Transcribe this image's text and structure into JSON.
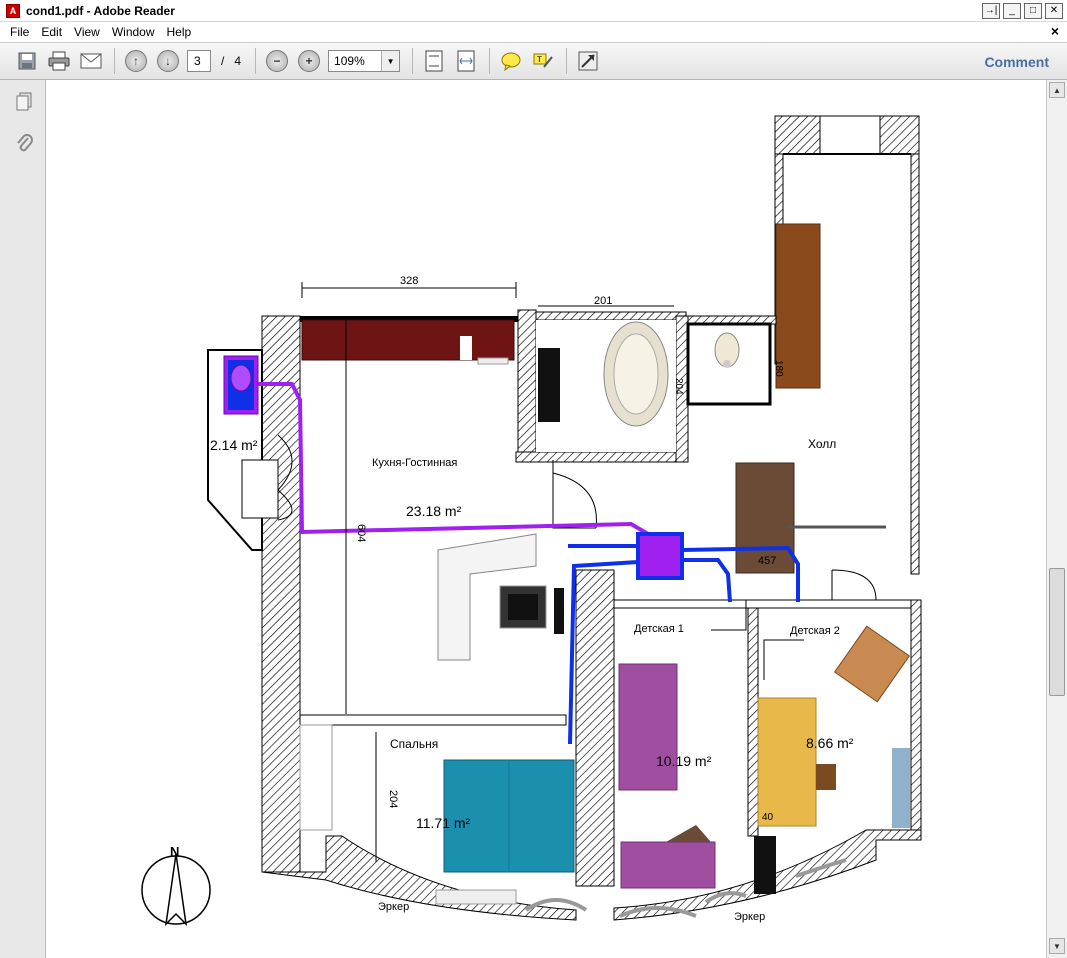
{
  "window": {
    "title": "cond1.pdf - Adobe Reader",
    "pdf_badge": "A"
  },
  "window_controls": {
    "restore": "→|",
    "minimize": "_",
    "maximize": "□",
    "close": "✕"
  },
  "menu": {
    "items": [
      "File",
      "Edit",
      "View",
      "Window",
      "Help"
    ],
    "doc_close": "×"
  },
  "toolbar": {
    "page_current": "3",
    "page_separator": "/",
    "page_total": "4",
    "zoom": "109%",
    "comment_label": "Comment"
  },
  "plan": {
    "dimensions": {
      "kitchen_width": "328",
      "bath_width": "201",
      "kitchen_height": "604",
      "hall_width": "457",
      "bedroom_height": "204",
      "wc_side": "204",
      "hall_side": "180",
      "small": "40"
    },
    "rooms": {
      "kitchen_living": "Кухня-Гостинная",
      "kitchen_area": "23.18 m²",
      "balcony_area": "2.14 m²",
      "hall": "Холл",
      "kids1": "Детская 1",
      "kids1_area": "10.19 m²",
      "kids2": "Детская 2",
      "kids2_area": "8.66 m²",
      "bedroom": "Спальня",
      "bedroom_area": "11.71 m²",
      "bay1": "Эркер",
      "bay2": "Эркер"
    },
    "compass_label": "N"
  },
  "colors": {
    "ac_purple": "#a020f0",
    "duct_blue": "#1030e8",
    "kitchen_cabinet": "#6e1414",
    "bed_teal": "#1a8fae",
    "desk_gold": "#e8b84a",
    "wardrobe_brown": "#8b4a1c",
    "sofa_brown": "#6b4a36",
    "violet_bed": "#a04fa0",
    "comment_blue": "#4a6fa1"
  }
}
